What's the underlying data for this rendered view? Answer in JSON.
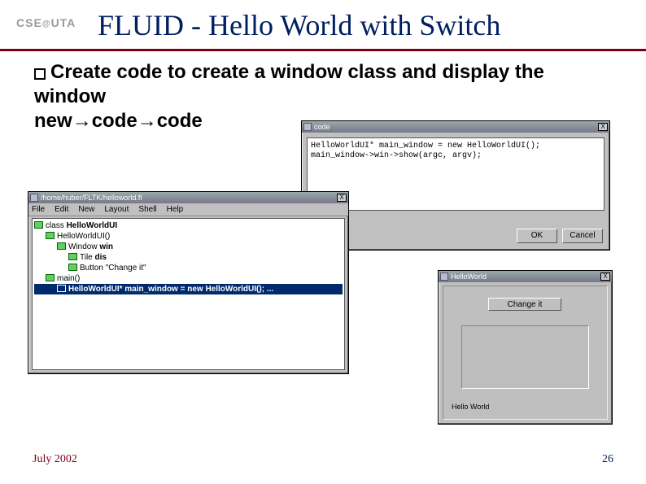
{
  "logo": "CSE@UTA",
  "slide": {
    "title": "FLUID - Hello World with Switch",
    "bullet": "Create code to create a window class and display the window new→code→code"
  },
  "code_dialog": {
    "title": "code",
    "close": "X",
    "text": "HelloWorldUI* main_window = new HelloWorldUI();\nmain_window->win->show(argc, argv);",
    "ok_label": "OK",
    "cancel_label": "Cancel"
  },
  "fluid": {
    "title": "/home/huber/FLTK/helloworld.fl",
    "close": "X",
    "menu": [
      "File",
      "Edit",
      "New",
      "Layout",
      "Shell",
      "Help"
    ],
    "tree": {
      "n0": "class HelloWorldUI",
      "n1": "HelloWorldUI()",
      "n2": "Window win",
      "n3": "Tile dis",
      "n4": "Button \"Change it\"",
      "n5": "main()",
      "n6": "HelloWorldUI* main_window = new HelloWorldUI(); ..."
    }
  },
  "hello": {
    "title": "HelloWorld",
    "close": "X",
    "change_label": "Change it",
    "greeting": "Hello World"
  },
  "footer": {
    "date": "July 2002",
    "page": "26"
  }
}
